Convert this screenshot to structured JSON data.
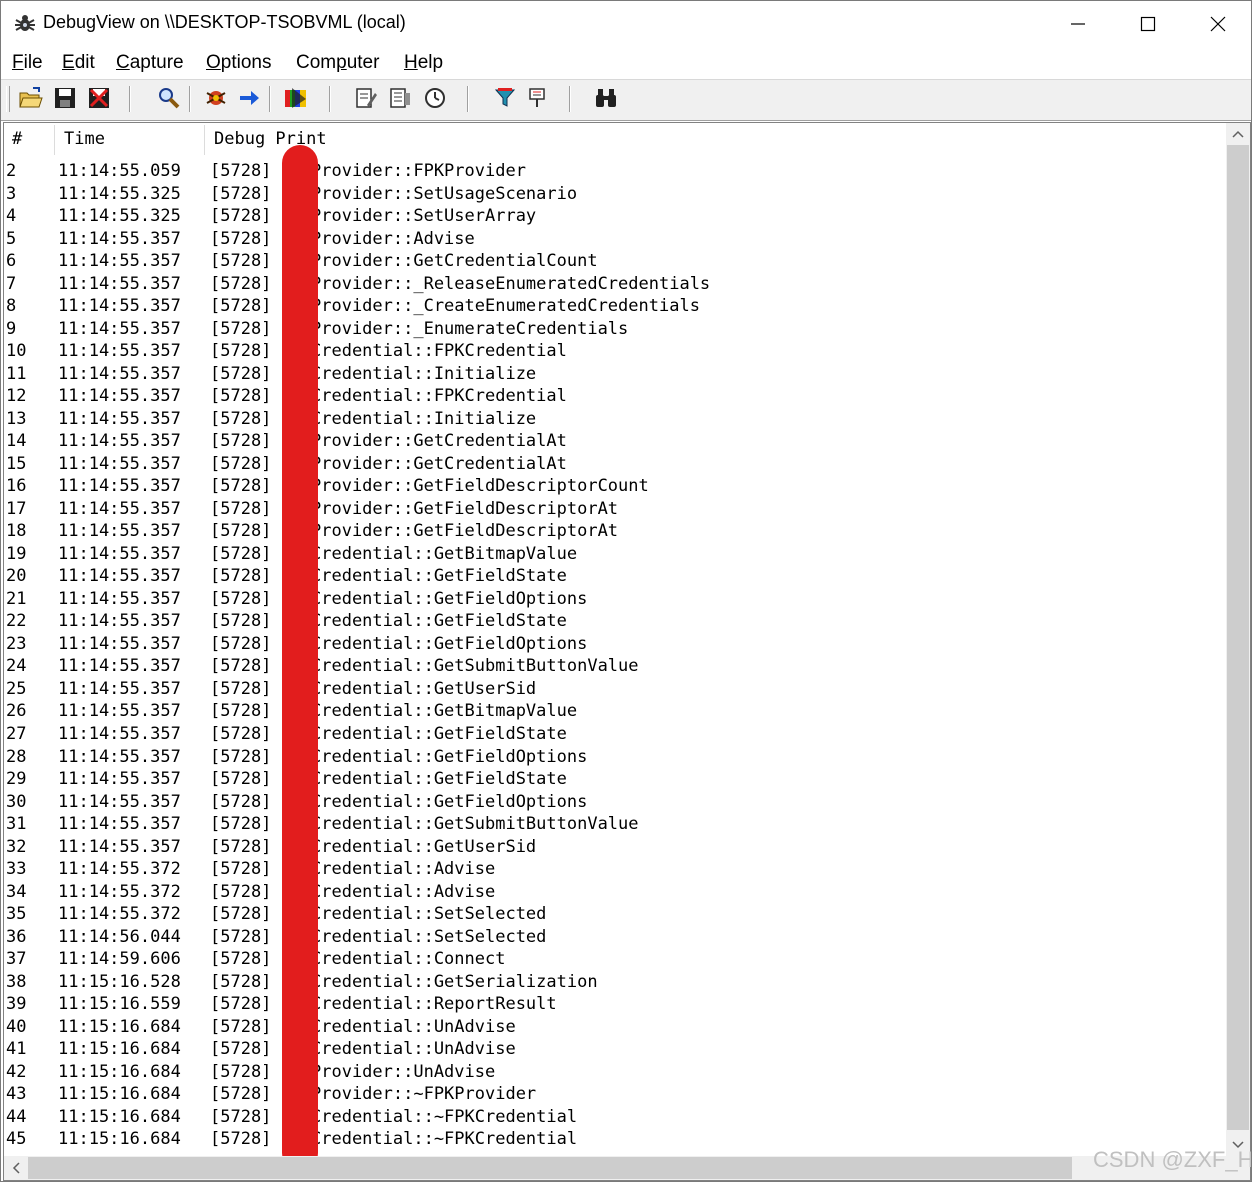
{
  "window": {
    "title": "DebugView on \\\\DESKTOP-TSOBVML (local)",
    "minimize_icon": "minimize-icon",
    "maximize_icon": "maximize-icon",
    "close_icon": "close-icon"
  },
  "menu": [
    {
      "accel": "F",
      "rest": "ile"
    },
    {
      "accel": "E",
      "rest": "dit"
    },
    {
      "accel": "C",
      "rest": "apture"
    },
    {
      "accel": "O",
      "rest": "ptions"
    },
    {
      "pre": "Com",
      "accel": "p",
      "rest": "uter"
    },
    {
      "accel": "H",
      "rest": "elp"
    }
  ],
  "toolbar": [
    "open-icon",
    "save-icon",
    "clear-display-icon",
    "find-icon",
    "capture-icon",
    "autoscroll-icon",
    "highlight-icon",
    "clock-time-icon",
    "filter-icon",
    "history-icon",
    "time-icon",
    "capture-win32-icon",
    "capture-kernel-icon",
    "binoculars-icon"
  ],
  "columns": {
    "num": "#",
    "time": "Time",
    "debug_print": "Debug Print"
  },
  "rows": [
    {
      "num": "2",
      "time": "11:14:55.059",
      "pid": "[5728]",
      "msg": "Provider::FPKProvider"
    },
    {
      "num": "3",
      "time": "11:14:55.325",
      "pid": "[5728]",
      "msg": "Provider::SetUsageScenario"
    },
    {
      "num": "4",
      "time": "11:14:55.325",
      "pid": "[5728]",
      "msg": "Provider::SetUserArray"
    },
    {
      "num": "5",
      "time": "11:14:55.357",
      "pid": "[5728]",
      "msg": "Provider::Advise"
    },
    {
      "num": "6",
      "time": "11:14:55.357",
      "pid": "[5728]",
      "msg": "Provider::GetCredentialCount"
    },
    {
      "num": "7",
      "time": "11:14:55.357",
      "pid": "[5728]",
      "msg": "Provider::_ReleaseEnumeratedCredentials"
    },
    {
      "num": "8",
      "time": "11:14:55.357",
      "pid": "[5728]",
      "msg": "Provider::_CreateEnumeratedCredentials"
    },
    {
      "num": "9",
      "time": "11:14:55.357",
      "pid": "[5728]",
      "msg": "Provider::_EnumerateCredentials"
    },
    {
      "num": "10",
      "time": "11:14:55.357",
      "pid": "[5728]",
      "msg": "Credential::FPKCredential"
    },
    {
      "num": "11",
      "time": "11:14:55.357",
      "pid": "[5728]",
      "msg": "Credential::Initialize"
    },
    {
      "num": "12",
      "time": "11:14:55.357",
      "pid": "[5728]",
      "msg": "Credential::FPKCredential"
    },
    {
      "num": "13",
      "time": "11:14:55.357",
      "pid": "[5728]",
      "msg": "Credential::Initialize"
    },
    {
      "num": "14",
      "time": "11:14:55.357",
      "pid": "[5728]",
      "msg": "Provider::GetCredentialAt"
    },
    {
      "num": "15",
      "time": "11:14:55.357",
      "pid": "[5728]",
      "msg": "Provider::GetCredentialAt"
    },
    {
      "num": "16",
      "time": "11:14:55.357",
      "pid": "[5728]",
      "msg": "Provider::GetFieldDescriptorCount"
    },
    {
      "num": "17",
      "time": "11:14:55.357",
      "pid": "[5728]",
      "msg": "Provider::GetFieldDescriptorAt"
    },
    {
      "num": "18",
      "time": "11:14:55.357",
      "pid": "[5728]",
      "msg": "Provider::GetFieldDescriptorAt"
    },
    {
      "num": "19",
      "time": "11:14:55.357",
      "pid": "[5728]",
      "msg": "Credential::GetBitmapValue"
    },
    {
      "num": "20",
      "time": "11:14:55.357",
      "pid": "[5728]",
      "msg": "Credential::GetFieldState"
    },
    {
      "num": "21",
      "time": "11:14:55.357",
      "pid": "[5728]",
      "msg": "Credential::GetFieldOptions"
    },
    {
      "num": "22",
      "time": "11:14:55.357",
      "pid": "[5728]",
      "msg": "Credential::GetFieldState"
    },
    {
      "num": "23",
      "time": "11:14:55.357",
      "pid": "[5728]",
      "msg": "Credential::GetFieldOptions"
    },
    {
      "num": "24",
      "time": "11:14:55.357",
      "pid": "[5728]",
      "msg": "Credential::GetSubmitButtonValue"
    },
    {
      "num": "25",
      "time": "11:14:55.357",
      "pid": "[5728]",
      "msg": "Credential::GetUserSid"
    },
    {
      "num": "26",
      "time": "11:14:55.357",
      "pid": "[5728]",
      "msg": "Credential::GetBitmapValue"
    },
    {
      "num": "27",
      "time": "11:14:55.357",
      "pid": "[5728]",
      "msg": "Credential::GetFieldState"
    },
    {
      "num": "28",
      "time": "11:14:55.357",
      "pid": "[5728]",
      "msg": "Credential::GetFieldOptions"
    },
    {
      "num": "29",
      "time": "11:14:55.357",
      "pid": "[5728]",
      "msg": "Credential::GetFieldState"
    },
    {
      "num": "30",
      "time": "11:14:55.357",
      "pid": "[5728]",
      "msg": "Credential::GetFieldOptions"
    },
    {
      "num": "31",
      "time": "11:14:55.357",
      "pid": "[5728]",
      "msg": "Credential::GetSubmitButtonValue"
    },
    {
      "num": "32",
      "time": "11:14:55.357",
      "pid": "[5728]",
      "msg": "Credential::GetUserSid"
    },
    {
      "num": "33",
      "time": "11:14:55.372",
      "pid": "[5728]",
      "msg": "Credential::Advise"
    },
    {
      "num": "34",
      "time": "11:14:55.372",
      "pid": "[5728]",
      "msg": "Credential::Advise"
    },
    {
      "num": "35",
      "time": "11:14:55.372",
      "pid": "[5728]",
      "msg": "Credential::SetSelected"
    },
    {
      "num": "36",
      "time": "11:14:56.044",
      "pid": "[5728]",
      "msg": "Credential::SetSelected"
    },
    {
      "num": "37",
      "time": "11:14:59.606",
      "pid": "[5728]",
      "msg": "Credential::Connect"
    },
    {
      "num": "38",
      "time": "11:15:16.528",
      "pid": "[5728]",
      "msg": "Credential::GetSerialization"
    },
    {
      "num": "39",
      "time": "11:15:16.559",
      "pid": "[5728]",
      "msg": "Credential::ReportResult"
    },
    {
      "num": "40",
      "time": "11:15:16.684",
      "pid": "[5728]",
      "msg": "Credential::UnAdvise"
    },
    {
      "num": "41",
      "time": "11:15:16.684",
      "pid": "[5728]",
      "msg": "Credential::UnAdvise"
    },
    {
      "num": "42",
      "time": "11:15:16.684",
      "pid": "[5728]",
      "msg": "Provider::UnAdvise"
    },
    {
      "num": "43",
      "time": "11:15:16.684",
      "pid": "[5728]",
      "msg": "Provider::~FPKProvider"
    },
    {
      "num": "44",
      "time": "11:15:16.684",
      "pid": "[5728]",
      "msg": "Credential::~FPKCredential"
    },
    {
      "num": "45",
      "time": "11:15:16.684",
      "pid": "[5728]",
      "msg": "Credential::~FPKCredential"
    }
  ],
  "redaction_color": "#e21d1d",
  "watermark": "CSDN @ZXF_H"
}
